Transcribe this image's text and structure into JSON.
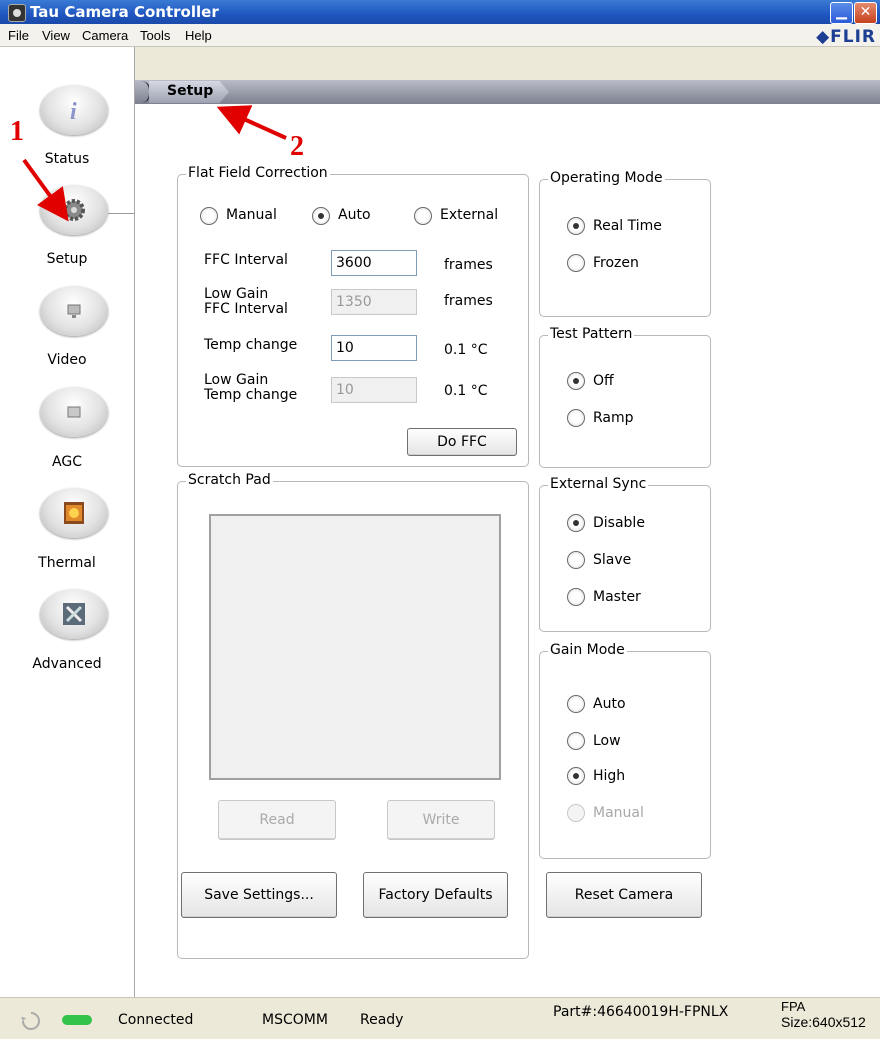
{
  "window": {
    "title": "Tau Camera Controller"
  },
  "menu": {
    "items": [
      "File",
      "View",
      "Camera",
      "Tools",
      "Help"
    ],
    "brand": "◆FLIR"
  },
  "sidebar": {
    "items": [
      {
        "label": "Status",
        "icon": "info-icon"
      },
      {
        "label": "Setup",
        "icon": "gear-icon"
      },
      {
        "label": "Video",
        "icon": "monitor-icon"
      },
      {
        "label": "AGC",
        "icon": "agc-icon"
      },
      {
        "label": "Thermal",
        "icon": "thermal-icon"
      },
      {
        "label": "Advanced",
        "icon": "tools-icon"
      }
    ]
  },
  "tab": {
    "label": "Setup"
  },
  "annotations": {
    "one": "1",
    "two": "2",
    "color": "#e00000"
  },
  "ffc": {
    "title": "Flat Field Correction",
    "modes": [
      "Manual",
      "Auto",
      "External"
    ],
    "selected": "Auto",
    "rows": [
      {
        "label": "FFC Interval",
        "value": "3600",
        "unit": "frames",
        "enabled": true
      },
      {
        "label": "Low Gain\nFFC Interval",
        "value": "1350",
        "unit": "frames",
        "enabled": false
      },
      {
        "label": "Temp change",
        "value": "10",
        "unit": "0.1 °C",
        "enabled": true
      },
      {
        "label": "Low Gain\nTemp change",
        "value": "10",
        "unit": "0.1 °C",
        "enabled": false
      }
    ],
    "do_ffc": "Do FFC"
  },
  "operating_mode": {
    "title": "Operating Mode",
    "options": [
      "Real Time",
      "Frozen"
    ],
    "selected": "Real Time"
  },
  "test_pattern": {
    "title": "Test Pattern",
    "options": [
      "Off",
      "Ramp"
    ],
    "selected": "Off"
  },
  "external_sync": {
    "title": "External Sync",
    "options": [
      "Disable",
      "Slave",
      "Master"
    ],
    "selected": "Disable"
  },
  "gain_mode": {
    "title": "Gain Mode",
    "options": [
      "Auto",
      "Low",
      "High",
      "Manual"
    ],
    "selected": "High",
    "disabled": [
      "Manual"
    ]
  },
  "scratch_pad": {
    "title": "Scratch Pad",
    "read": "Read",
    "write": "Write"
  },
  "actions": {
    "save": "Save Settings...",
    "factory": "Factory Defaults",
    "reset": "Reset Camera"
  },
  "status": {
    "connected": "Connected",
    "port": "MSCOMM",
    "state": "Ready",
    "part": "Part#:46640019H-FPNLX",
    "fpa_label": "FPA",
    "fpa_size": "Size:640x512",
    "led_color": "#33c24a"
  }
}
